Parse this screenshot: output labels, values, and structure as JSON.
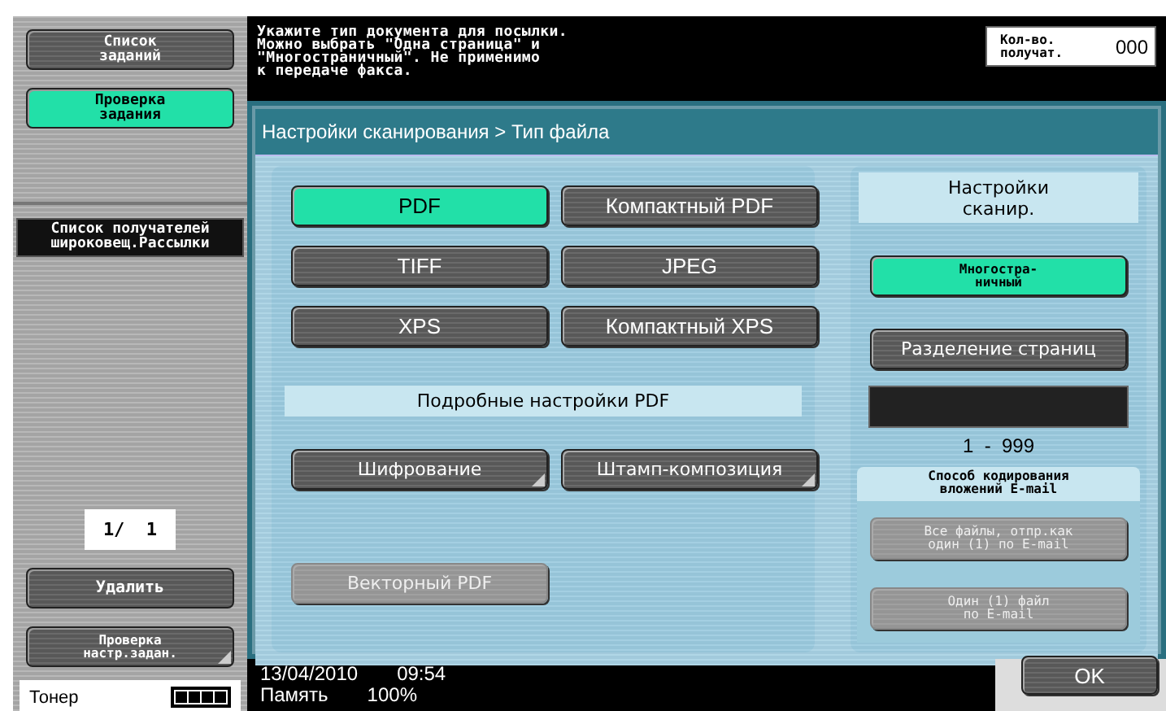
{
  "sidebar": {
    "buttons": [
      {
        "label": "Список\nзаданий",
        "selected": false
      },
      {
        "label": "Проверка\nзадания",
        "selected": true
      }
    ],
    "list_label": "Список получателей\nшироковещ.Рассылки",
    "page_counter": "1/  1",
    "delete_button": "Удалить",
    "check_settings_button": "Проверка\nнастр.задан.",
    "toner": {
      "label": "Тонер"
    }
  },
  "message": "Укажите тип документа для посылки.\nМожно выбрать \"Одна страница\" и\n\"Многостраничный\". Не применимо\nк передаче факса.",
  "recipients": {
    "label": "Кол-во.\nполучат.",
    "value": "000"
  },
  "panel": {
    "title": "Настройки сканирования > Тип файла",
    "file_types": [
      {
        "label": "PDF",
        "selected": true
      },
      {
        "label": "Компактный PDF",
        "selected": false
      },
      {
        "label": "TIFF",
        "selected": false
      },
      {
        "label": "JPEG",
        "selected": false
      },
      {
        "label": "XPS",
        "selected": false
      },
      {
        "label": "Компактный XPS",
        "selected": false
      }
    ],
    "pdf_settings": {
      "title": "Подробные настройки PDF",
      "buttons": [
        {
          "label": "Шифрование",
          "disabled": false
        },
        {
          "label": "Штамп-композиция",
          "disabled": false
        }
      ],
      "vector_button": {
        "label": "Векторный PDF",
        "disabled": true
      }
    },
    "scan_settings": {
      "title": "Настройки\nсканир.",
      "multipage": {
        "label": "Многостра-\nничный",
        "selected": true
      },
      "page_split": {
        "label": "Разделение страниц",
        "selected": false
      },
      "range": "1  -  999"
    },
    "email_encoding": {
      "title": "Способ кодирования\nвложений E-mail",
      "options": [
        {
          "label": "Все файлы, отпр.как\nодин (1) по E-mail",
          "disabled": true
        },
        {
          "label": "Один (1) файл\nпо E-mail",
          "disabled": true
        }
      ]
    }
  },
  "footer": {
    "date": "13/04/2010",
    "time": "09:54",
    "memory_label": "Память",
    "memory_value": "100%",
    "ok_button": "OK"
  }
}
